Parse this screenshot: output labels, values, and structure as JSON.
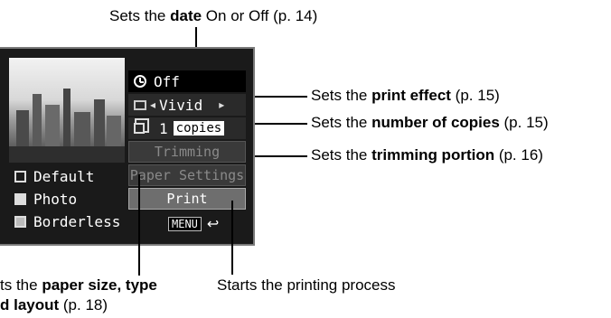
{
  "annotations": {
    "date": {
      "pre": "Sets the ",
      "bold": "date",
      "post": " On or Off (p. 14)"
    },
    "print_effect": {
      "pre": "Sets the ",
      "bold": "print effect",
      "post": " (p. 15)"
    },
    "copies": {
      "pre": "Sets the ",
      "bold": "number of copies",
      "post": " (p. 15)"
    },
    "trimming": {
      "pre": "Sets the ",
      "bold": "trimming portion",
      "post": " (p. 16)"
    },
    "paper_line1_pre": "ts the ",
    "paper_line1_bold": "paper size, type",
    "paper_line2_bold": "d layout",
    "paper_line2_post": " (p. 18)",
    "printing": "Starts the printing process"
  },
  "screen": {
    "date_value": "Off",
    "effect_value": "Vivid",
    "copies_count": "1",
    "copies_label": "copies",
    "trimming": "Trimming",
    "paper_settings": "Paper Settings",
    "print": "Print",
    "menu_button": "MENU",
    "paper_options": [
      {
        "label": "Default"
      },
      {
        "label": "Photo"
      },
      {
        "label": "Borderless"
      }
    ]
  }
}
